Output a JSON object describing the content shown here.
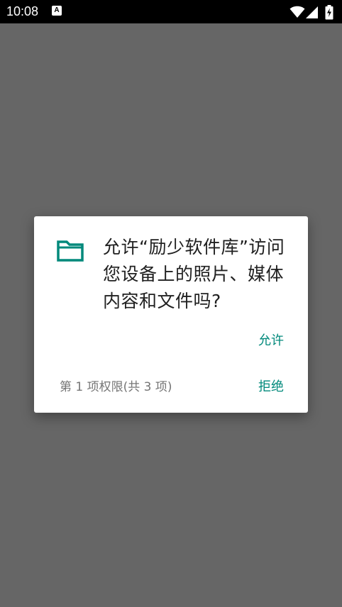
{
  "status_bar": {
    "time": "10:08",
    "notification_icon": "a-text-icon",
    "icons": [
      "wifi-icon",
      "signal-icon",
      "battery-charging-icon"
    ]
  },
  "dialog": {
    "icon": "folder-icon",
    "message": "允许“励少软件库”访问您设备上的照片、媒体内容和文件吗?",
    "allow_label": "允许",
    "deny_label": "拒绝",
    "permission_counter": "第 1 项权限(共 3 项)"
  },
  "colors": {
    "accent": "#00897b",
    "scrim": "#666666",
    "status_bar": "#000000",
    "dialog_bg": "#ffffff",
    "secondary_text": "#757575"
  }
}
